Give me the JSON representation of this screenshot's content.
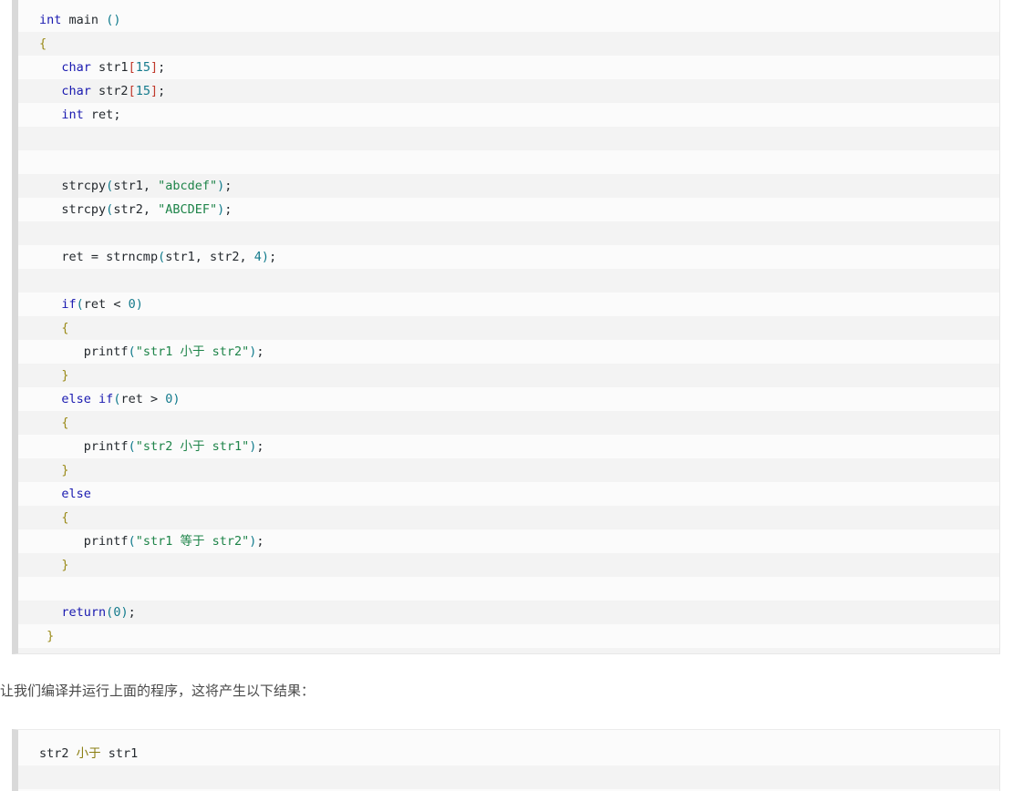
{
  "code_block": {
    "name": "c-source-strncmp-example",
    "language": "c",
    "lines": [
      [
        {
          "t": "int",
          "c": "kw"
        },
        {
          "t": " ",
          "c": "op"
        },
        {
          "t": "main",
          "c": "id"
        },
        {
          "t": " ",
          "c": "op"
        },
        {
          "t": "()",
          "c": "paren"
        }
      ],
      [
        {
          "t": "{",
          "c": "brace"
        }
      ],
      [
        {
          "t": "   ",
          "c": "op"
        },
        {
          "t": "char",
          "c": "kw"
        },
        {
          "t": " ",
          "c": "op"
        },
        {
          "t": "str1",
          "c": "id"
        },
        {
          "t": "[",
          "c": "brack"
        },
        {
          "t": "15",
          "c": "num"
        },
        {
          "t": "]",
          "c": "brack"
        },
        {
          "t": ";",
          "c": "op"
        }
      ],
      [
        {
          "t": "   ",
          "c": "op"
        },
        {
          "t": "char",
          "c": "kw"
        },
        {
          "t": " ",
          "c": "op"
        },
        {
          "t": "str2",
          "c": "id"
        },
        {
          "t": "[",
          "c": "brack"
        },
        {
          "t": "15",
          "c": "num"
        },
        {
          "t": "]",
          "c": "brack"
        },
        {
          "t": ";",
          "c": "op"
        }
      ],
      [
        {
          "t": "   ",
          "c": "op"
        },
        {
          "t": "int",
          "c": "kw"
        },
        {
          "t": " ",
          "c": "op"
        },
        {
          "t": "ret",
          "c": "id"
        },
        {
          "t": ";",
          "c": "op"
        }
      ],
      [],
      [],
      [
        {
          "t": "   ",
          "c": "op"
        },
        {
          "t": "strcpy",
          "c": "id"
        },
        {
          "t": "(",
          "c": "paren"
        },
        {
          "t": "str1",
          "c": "id"
        },
        {
          "t": ", ",
          "c": "op"
        },
        {
          "t": "\"abcdef\"",
          "c": "str"
        },
        {
          "t": ")",
          "c": "paren"
        },
        {
          "t": ";",
          "c": "op"
        }
      ],
      [
        {
          "t": "   ",
          "c": "op"
        },
        {
          "t": "strcpy",
          "c": "id"
        },
        {
          "t": "(",
          "c": "paren"
        },
        {
          "t": "str2",
          "c": "id"
        },
        {
          "t": ", ",
          "c": "op"
        },
        {
          "t": "\"ABCDEF\"",
          "c": "str"
        },
        {
          "t": ")",
          "c": "paren"
        },
        {
          "t": ";",
          "c": "op"
        }
      ],
      [],
      [
        {
          "t": "   ",
          "c": "op"
        },
        {
          "t": "ret",
          "c": "id"
        },
        {
          "t": " = ",
          "c": "op"
        },
        {
          "t": "strncmp",
          "c": "id"
        },
        {
          "t": "(",
          "c": "paren"
        },
        {
          "t": "str1",
          "c": "id"
        },
        {
          "t": ", ",
          "c": "op"
        },
        {
          "t": "str2",
          "c": "id"
        },
        {
          "t": ", ",
          "c": "op"
        },
        {
          "t": "4",
          "c": "num"
        },
        {
          "t": ")",
          "c": "paren"
        },
        {
          "t": ";",
          "c": "op"
        }
      ],
      [],
      [
        {
          "t": "   ",
          "c": "op"
        },
        {
          "t": "if",
          "c": "kw"
        },
        {
          "t": "(",
          "c": "paren"
        },
        {
          "t": "ret",
          "c": "id"
        },
        {
          "t": " < ",
          "c": "op"
        },
        {
          "t": "0",
          "c": "num"
        },
        {
          "t": ")",
          "c": "paren"
        }
      ],
      [
        {
          "t": "   ",
          "c": "op"
        },
        {
          "t": "{",
          "c": "brace"
        }
      ],
      [
        {
          "t": "      ",
          "c": "op"
        },
        {
          "t": "printf",
          "c": "id"
        },
        {
          "t": "(",
          "c": "paren"
        },
        {
          "t": "\"str1 小于 str2\"",
          "c": "str"
        },
        {
          "t": ")",
          "c": "paren"
        },
        {
          "t": ";",
          "c": "op"
        }
      ],
      [
        {
          "t": "   ",
          "c": "op"
        },
        {
          "t": "}",
          "c": "brace"
        }
      ],
      [
        {
          "t": "   ",
          "c": "op"
        },
        {
          "t": "else",
          "c": "kw"
        },
        {
          "t": " ",
          "c": "op"
        },
        {
          "t": "if",
          "c": "kw"
        },
        {
          "t": "(",
          "c": "paren"
        },
        {
          "t": "ret",
          "c": "id"
        },
        {
          "t": " > ",
          "c": "op"
        },
        {
          "t": "0",
          "c": "num"
        },
        {
          "t": ")",
          "c": "paren"
        }
      ],
      [
        {
          "t": "   ",
          "c": "op"
        },
        {
          "t": "{",
          "c": "brace"
        }
      ],
      [
        {
          "t": "      ",
          "c": "op"
        },
        {
          "t": "printf",
          "c": "id"
        },
        {
          "t": "(",
          "c": "paren"
        },
        {
          "t": "\"str2 小于 str1\"",
          "c": "str"
        },
        {
          "t": ")",
          "c": "paren"
        },
        {
          "t": ";",
          "c": "op"
        }
      ],
      [
        {
          "t": "   ",
          "c": "op"
        },
        {
          "t": "}",
          "c": "brace"
        }
      ],
      [
        {
          "t": "   ",
          "c": "op"
        },
        {
          "t": "else",
          "c": "kw"
        }
      ],
      [
        {
          "t": "   ",
          "c": "op"
        },
        {
          "t": "{",
          "c": "brace"
        }
      ],
      [
        {
          "t": "      ",
          "c": "op"
        },
        {
          "t": "printf",
          "c": "id"
        },
        {
          "t": "(",
          "c": "paren"
        },
        {
          "t": "\"str1 等于 str2\"",
          "c": "str"
        },
        {
          "t": ")",
          "c": "paren"
        },
        {
          "t": ";",
          "c": "op"
        }
      ],
      [
        {
          "t": "   ",
          "c": "op"
        },
        {
          "t": "}",
          "c": "brace"
        }
      ],
      [],
      [
        {
          "t": "   ",
          "c": "op"
        },
        {
          "t": "return",
          "c": "kw"
        },
        {
          "t": "(",
          "c": "paren"
        },
        {
          "t": "0",
          "c": "num"
        },
        {
          "t": ")",
          "c": "paren"
        },
        {
          "t": ";",
          "c": "op"
        }
      ],
      [
        {
          "t": " ",
          "c": "op"
        },
        {
          "t": "}",
          "c": "brace"
        }
      ],
      []
    ]
  },
  "prose": {
    "text": "让我们编译并运行上面的程序，这将产生以下结果："
  },
  "output_block": {
    "name": "program-output",
    "lines": [
      [
        {
          "t": "str2 ",
          "c": "id"
        },
        {
          "t": "小于",
          "c": "olive"
        },
        {
          "t": " str1",
          "c": "id"
        }
      ],
      []
    ]
  },
  "colors": {
    "keyword": "#1a1ab0",
    "string": "#1e8449",
    "number": "#147a8c",
    "paren": "#0f7a8c",
    "brace": "#9a8a18",
    "bracket": "#c0392b",
    "identifier": "#24292e",
    "olive": "#8a7d10",
    "stripe_light": "#fbfbfb",
    "stripe_dark": "#f3f3f3",
    "left_border": "#d9d9d9",
    "prose_text": "#4a4a4a"
  }
}
